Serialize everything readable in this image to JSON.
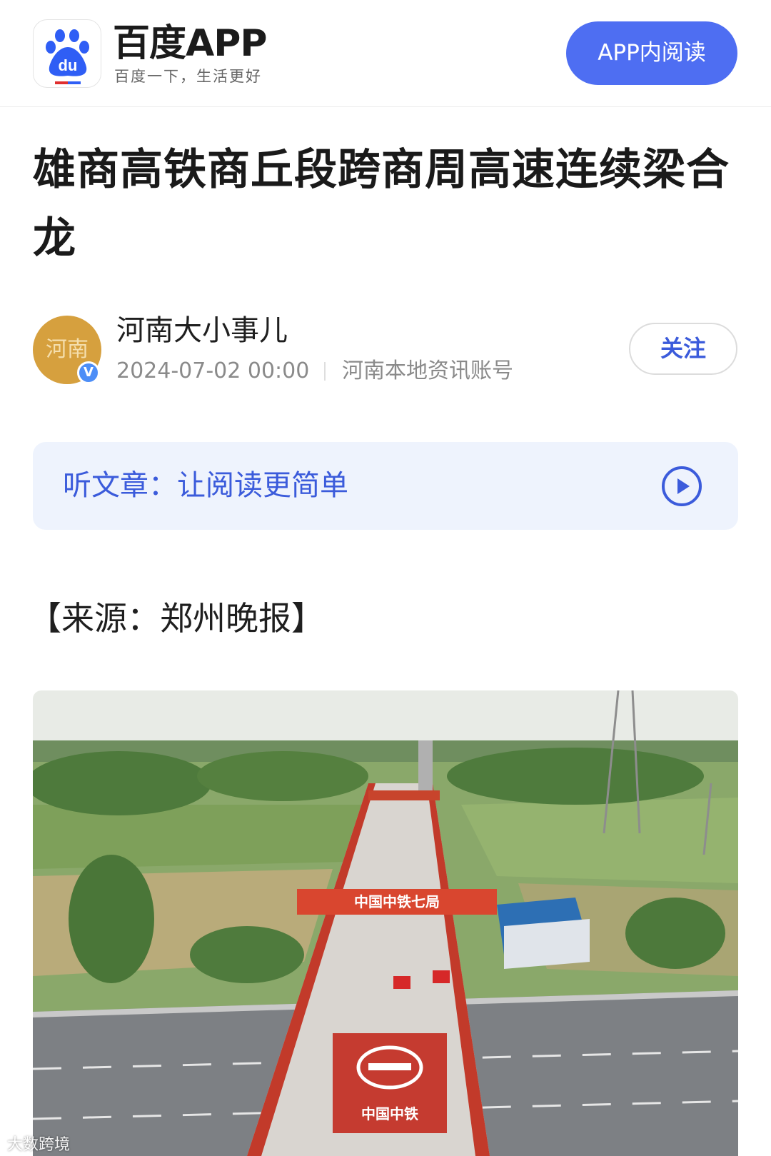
{
  "header": {
    "brand_name": "百度APP",
    "slogan": "百度一下，生活更好",
    "open_app_label": "APP内阅读",
    "logo_icon": "baidu-paw-logo",
    "logo_text": "du"
  },
  "article": {
    "title": "雄商高铁商丘段跨商周高速连续梁合龙",
    "source": "【来源：郑州晚报】"
  },
  "author": {
    "name": "河南大小事儿",
    "avatar_text": "河南",
    "verified_mark": "V",
    "publish_time": "2024-07-02 00:00",
    "description": "河南本地资讯账号",
    "follow_label": "关注"
  },
  "listen": {
    "label": "听文章：让阅读更简单",
    "icon": "play-circle-icon"
  },
  "photo": {
    "banner_text": "中国中铁七局",
    "ground_text": "中国中铁",
    "watermark": "大数跨境"
  },
  "colors": {
    "accent": "#4e6ef2",
    "link_blue": "#3b5bdb",
    "banner_bg": "#eef3fd",
    "avatar_gold": "#d6a03e"
  }
}
